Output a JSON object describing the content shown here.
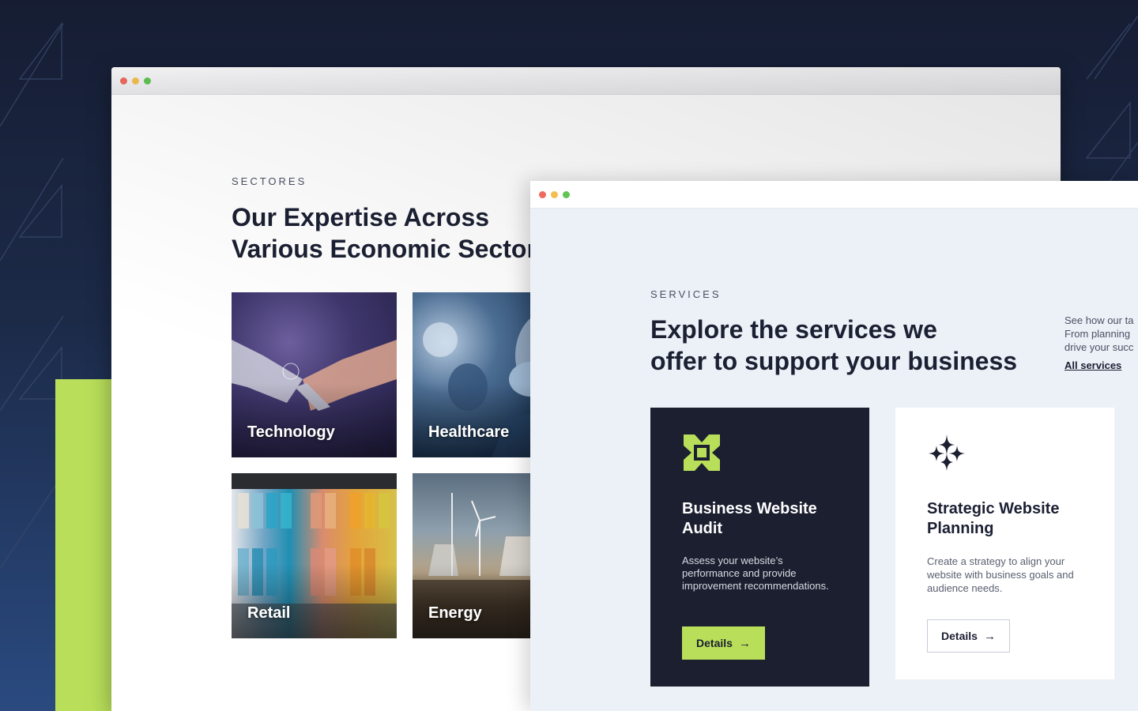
{
  "back_window": {
    "eyebrow": "SECTORES",
    "title": "Our Expertise Across\nVarious Economic Sectors",
    "sectors": [
      {
        "label": "Technology"
      },
      {
        "label": "Healthcare"
      },
      {
        "label": "Retail"
      },
      {
        "label": "Energy"
      }
    ]
  },
  "front_window": {
    "eyebrow": "SERVICES",
    "title": "Explore the services we\noffer to support your business",
    "side_text": [
      "See how our ta",
      "From planning",
      "drive your succ"
    ],
    "all_services_link": "All services",
    "cards": [
      {
        "icon": "lime-abstract-square-icon",
        "title": "Business Website\nAudit",
        "description": " Assess your website’s performance and provide improvement recommendations.",
        "button_label": "Details"
      },
      {
        "icon": "sparkles-icon",
        "title": "Strategic Website\nPlanning",
        "description": "Create a strategy to align your website with business goals and audience needs.",
        "button_label": "Details"
      }
    ]
  },
  "colors": {
    "accent_lime": "#b9df5a",
    "dark_navy": "#1b1f30",
    "page_bg_light": "#ecf0f7"
  }
}
